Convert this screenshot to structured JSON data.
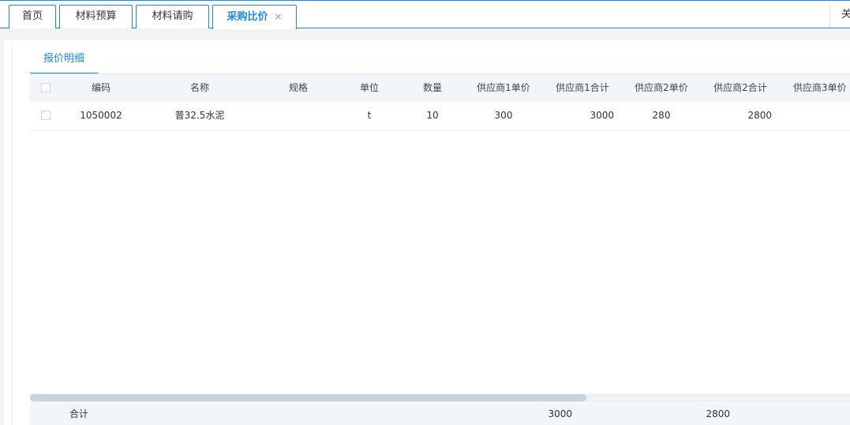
{
  "tabs": [
    {
      "label": "首页"
    },
    {
      "label": "材料预算"
    },
    {
      "label": "材料请购"
    },
    {
      "label": "采购比价",
      "close": "×"
    }
  ],
  "tabbar_right": "关",
  "subtab": "报价明细",
  "table": {
    "headers": [
      "编码",
      "名称",
      "规格",
      "单位",
      "数量",
      "供应商1单价",
      "供应商1合计",
      "供应商2单价",
      "供应商2合计",
      "供应商3单价"
    ],
    "rows": [
      [
        "1050002",
        "普32.5水泥",
        "",
        "t",
        "10",
        "300",
        "3000",
        "280",
        "2800",
        ""
      ]
    ],
    "footer": {
      "label": "合计",
      "supplier1_total": "3000",
      "supplier2_total": "2800"
    }
  },
  "colors": {
    "accent": "#1e88e5"
  }
}
